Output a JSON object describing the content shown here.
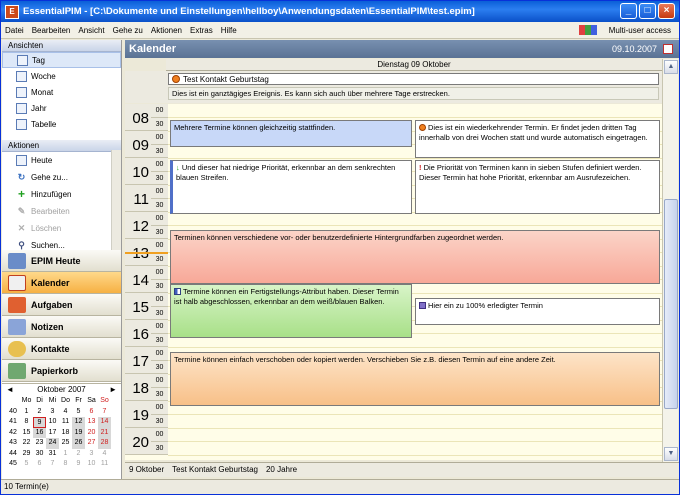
{
  "window": {
    "title": "EssentialPIM - [C:\\Dokumente und Einstellungen\\hellboy\\Anwendungsdaten\\EssentialPIM\\test.epim]"
  },
  "menubar": {
    "items": [
      "Datei",
      "Bearbeiten",
      "Ansicht",
      "Gehe zu",
      "Aktionen",
      "Extras",
      "Hilfe"
    ],
    "multiuser": "Multi-user access"
  },
  "sidebar": {
    "views_header": "Ansichten",
    "views": [
      "Tag",
      "Woche",
      "Monat",
      "Jahr",
      "Tabelle"
    ],
    "actions_header": "Aktionen",
    "actions": [
      "Heute",
      "Gehe zu...",
      "Hinzufügen",
      "Bearbeiten",
      "Löschen",
      "Suchen..."
    ],
    "modules": [
      "EPIM Heute",
      "Kalender",
      "Aufgaben",
      "Notizen",
      "Kontakte",
      "Papierkorb"
    ]
  },
  "minical": {
    "month": "Oktober",
    "year": "2007",
    "day_headers": [
      "Mo",
      "Di",
      "Mi",
      "Do",
      "Fr",
      "Sa",
      "So"
    ],
    "weeks": [
      {
        "wk": "40",
        "days": [
          "1",
          "2",
          "3",
          "4",
          "5",
          "6",
          "7"
        ]
      },
      {
        "wk": "41",
        "days": [
          "8",
          "9",
          "10",
          "11",
          "12",
          "13",
          "14"
        ]
      },
      {
        "wk": "42",
        "days": [
          "15",
          "16",
          "17",
          "18",
          "19",
          "20",
          "21"
        ]
      },
      {
        "wk": "43",
        "days": [
          "22",
          "23",
          "24",
          "25",
          "26",
          "27",
          "28"
        ]
      },
      {
        "wk": "44",
        "days": [
          "29",
          "30",
          "31",
          "1",
          "2",
          "3",
          "4"
        ]
      },
      {
        "wk": "45",
        "days": [
          "5",
          "6",
          "7",
          "8",
          "9",
          "10",
          "11"
        ]
      }
    ]
  },
  "main": {
    "title": "Kalender",
    "date": "09.10.2007",
    "day_label": "Dienstag 09 Oktober",
    "allday_event": "Test Kontakt Geburtstag",
    "allday_note": "Dies ist ein ganztägiges Ereignis. Es kann sich auch über mehrere Tage erstrecken.",
    "hours": [
      "08",
      "09",
      "10",
      "11",
      "12",
      "13",
      "14",
      "15",
      "16",
      "17",
      "18",
      "19",
      "20"
    ],
    "minutes": [
      "00",
      "30"
    ],
    "events": {
      "e1": "Mehrere Termine können gleichzeitig stattfinden.",
      "e2": "Dies ist ein wiederkehrender Termin. Er findet jeden dritten Tag innerhalb von drei Wochen statt und wurde automatisch eingetragen.",
      "e3": "Und dieser hat niedrige Priorität, erkennbar an dem senkrechten blauen Streifen.",
      "e4": "Die Priorität von Terminen kann in sieben Stufen definiert werden. Dieser Termin hat hohe Priorität, erkennbar am Ausrufezeichen.",
      "e5": "Terminen können verschiedene vor- oder benutzerdefinierte Hintergrundfarben zugeordnet werden.",
      "e6": "Termine können ein Fertigstellungs-Attribut haben. Dieser Termin ist halb abgeschlossen, erkennbar an dem weiß/blauen Balken.",
      "e7": "Hier ein zu 100% erledigter Termin",
      "e8": "Termine können einfach verschoben oder kopiert werden. Verschieben Sie z.B. diesen Termin auf eine andere Zeit."
    },
    "footer": {
      "date": "9 Oktober",
      "text": "Test Kontakt Geburtstag",
      "years": "20 Jahre"
    }
  },
  "status": {
    "text": "10 Termin(e)"
  },
  "colors": {
    "title_blue": "#0a5fd8",
    "selected_module": "#f6b043",
    "event_blue": "#c8d8f8",
    "event_red": "#f8b8a8",
    "event_green": "#b8e8a0",
    "event_orange": "#fad0a0"
  }
}
